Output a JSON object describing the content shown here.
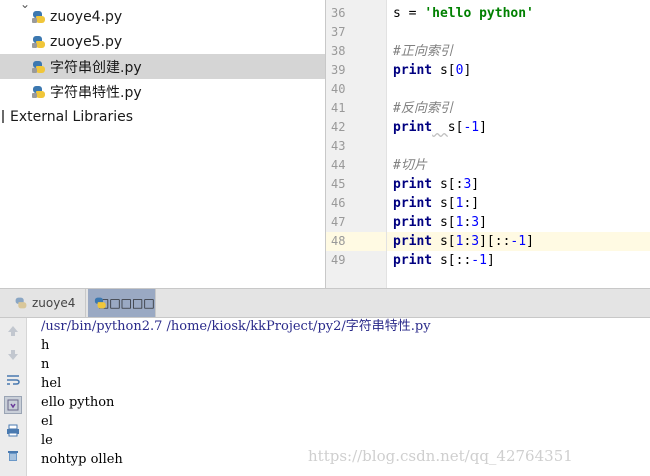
{
  "project_tree": {
    "items": [
      {
        "label": "zuoye4.py",
        "selected": false
      },
      {
        "label": "zuoye5.py",
        "selected": false
      },
      {
        "label": "字符串创建.py",
        "selected": true
      },
      {
        "label": "字符串特性.py",
        "selected": false
      }
    ],
    "external_libraries": "External Libraries"
  },
  "editor": {
    "line_numbers": [
      "36",
      "37",
      "38",
      "39",
      "40",
      "41",
      "42",
      "43",
      "44",
      "45",
      "46",
      "47",
      "48",
      "49"
    ],
    "current_line": "48",
    "lines": {
      "l36_var": "s = ",
      "l36_str": "'hello python'",
      "l38_comment": "#正向索引",
      "l39_kw": "print",
      "l39_a": " s[",
      "l39_n": "0",
      "l39_b": "]",
      "l41_comment": "#反向索引",
      "l42_kw": "print",
      "l42_sp": "  ",
      "l42_a": "s[",
      "l42_n": "-1",
      "l42_b": "]",
      "l44_comment": "#切片",
      "l45_kw": "print",
      "l45_a": " s[:",
      "l45_n": "3",
      "l45_b": "]",
      "l46_kw": "print",
      "l46_a": " s[",
      "l46_n": "1",
      "l46_b": ":]",
      "l47_kw": "print",
      "l47_a": " s[",
      "l47_n1": "1",
      "l47_m": ":",
      "l47_n2": "3",
      "l47_b": "]",
      "l48_kw": "print",
      "l48_a": " s[",
      "l48_n1": "1",
      "l48_m": ":",
      "l48_n2": "3",
      "l48_c": "][::",
      "l48_n3": "-1",
      "l48_b": "]",
      "l49_kw": "print",
      "l49_a": " s[::",
      "l49_n": "-1",
      "l49_b": "]"
    }
  },
  "run_tabs": [
    {
      "label": "zuoye4",
      "active": false
    },
    {
      "label": "□□□□□",
      "active": true
    }
  ],
  "console": {
    "command": "/usr/bin/python2.7 /home/kiosk/kkProject/py2/字符串特性.py",
    "output": [
      "h",
      "n",
      "hel",
      "ello python",
      "el",
      "le",
      "nohtyp olleh"
    ]
  },
  "watermark": "https://blog.csdn.net/qq_42764351",
  "colors": {
    "selection": "#d5d5d5",
    "current_line": "#fffae3",
    "keyword": "#000080",
    "string": "#008000",
    "number": "#0000ff",
    "comment": "#808080",
    "active_tab": "#9aa9c3"
  }
}
